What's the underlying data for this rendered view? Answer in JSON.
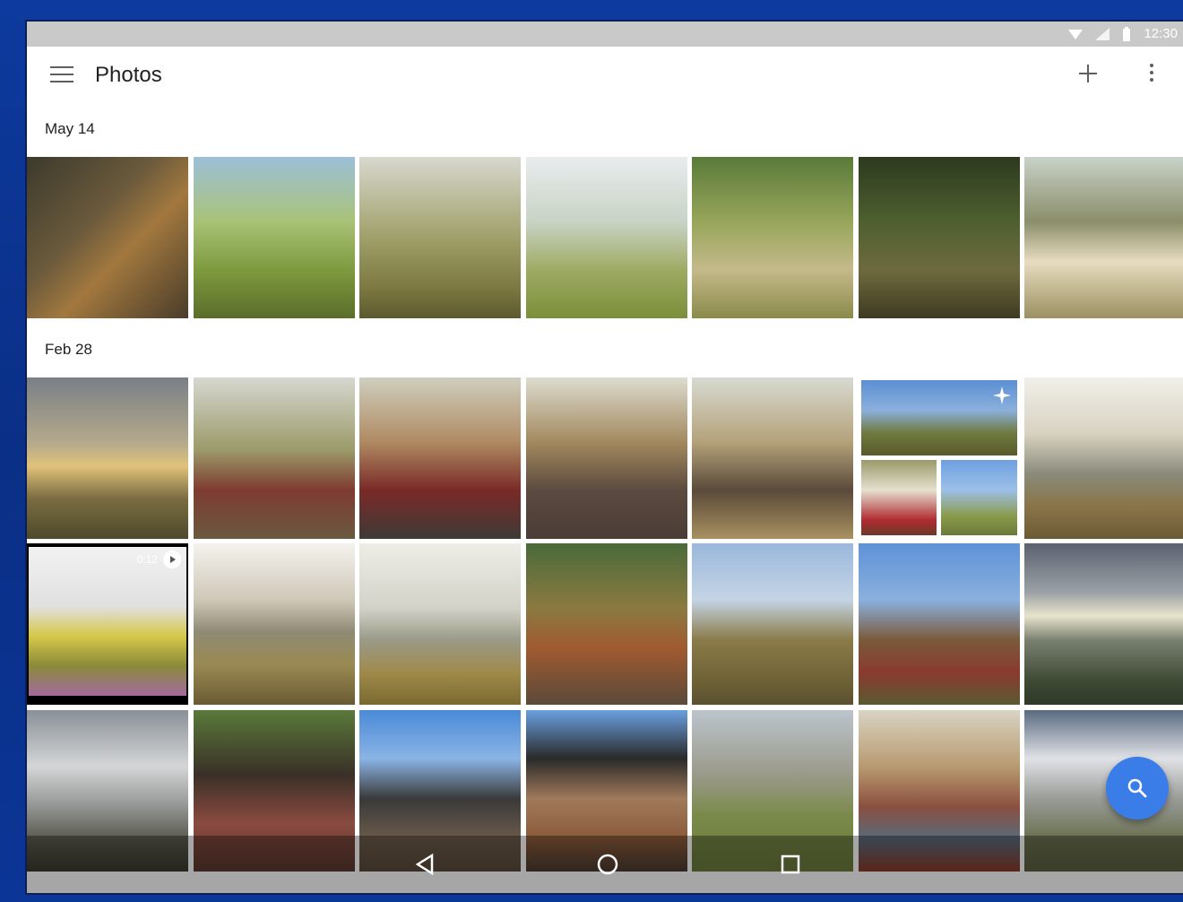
{
  "status": {
    "time": "12:30"
  },
  "app": {
    "title": "Photos"
  },
  "sections": [
    {
      "label": "May 14"
    },
    {
      "label": "Feb 28"
    }
  ],
  "video": {
    "duration": "0:12"
  },
  "icons": [
    "menu-icon",
    "add-icon",
    "more-icon",
    "search-icon",
    "back-icon",
    "home-icon",
    "recents-icon",
    "wifi-icon",
    "signal-icon",
    "battery-icon",
    "sparkle-icon",
    "play-icon"
  ],
  "colors": {
    "fab": "#3b7de8",
    "statusbar": "#c9c9c9",
    "frame": "#0b2a7a"
  }
}
